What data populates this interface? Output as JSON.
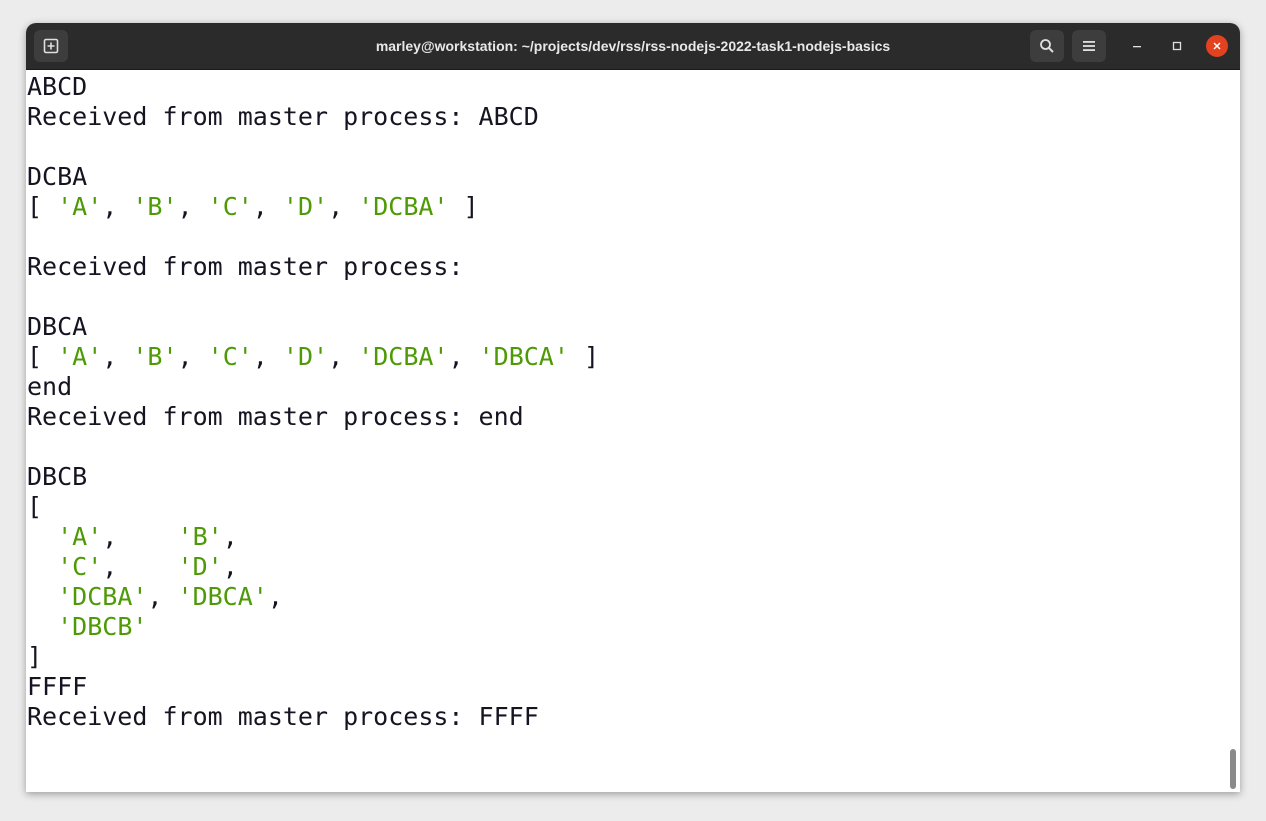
{
  "window": {
    "title": "marley@workstation: ~/projects/dev/rss/rss-nodejs-2022-task1-nodejs-basics"
  },
  "titlebar": {
    "new_tab_icon": "new-tab-icon",
    "search_icon": "search-icon",
    "menu_icon": "hamburger-menu-icon",
    "minimize_icon": "minimize-icon",
    "maximize_icon": "maximize-icon",
    "close_icon": "close-icon"
  },
  "colors": {
    "string_green": "#4e9a06",
    "text": "#171421",
    "close_red": "#e2421f"
  },
  "terminal": {
    "lines": [
      [
        {
          "t": "ABCD"
        }
      ],
      [
        {
          "t": "Received from master process: ABCD"
        }
      ],
      [],
      [
        {
          "t": "DCBA"
        }
      ],
      [
        {
          "t": "[ "
        },
        {
          "t": "'A'",
          "g": 1
        },
        {
          "t": ", "
        },
        {
          "t": "'B'",
          "g": 1
        },
        {
          "t": ", "
        },
        {
          "t": "'C'",
          "g": 1
        },
        {
          "t": ", "
        },
        {
          "t": "'D'",
          "g": 1
        },
        {
          "t": ", "
        },
        {
          "t": "'DCBA'",
          "g": 1
        },
        {
          "t": " ]"
        }
      ],
      [],
      [
        {
          "t": "Received from master process:"
        }
      ],
      [],
      [
        {
          "t": "DBCA"
        }
      ],
      [
        {
          "t": "[ "
        },
        {
          "t": "'A'",
          "g": 1
        },
        {
          "t": ", "
        },
        {
          "t": "'B'",
          "g": 1
        },
        {
          "t": ", "
        },
        {
          "t": "'C'",
          "g": 1
        },
        {
          "t": ", "
        },
        {
          "t": "'D'",
          "g": 1
        },
        {
          "t": ", "
        },
        {
          "t": "'DCBA'",
          "g": 1
        },
        {
          "t": ", "
        },
        {
          "t": "'DBCA'",
          "g": 1
        },
        {
          "t": " ]"
        }
      ],
      [
        {
          "t": "end"
        }
      ],
      [
        {
          "t": "Received from master process: end"
        }
      ],
      [],
      [
        {
          "t": "DBCB"
        }
      ],
      [
        {
          "t": "["
        }
      ],
      [
        {
          "t": "  "
        },
        {
          "t": "'A'",
          "g": 1
        },
        {
          "t": ",    "
        },
        {
          "t": "'B'",
          "g": 1
        },
        {
          "t": ","
        }
      ],
      [
        {
          "t": "  "
        },
        {
          "t": "'C'",
          "g": 1
        },
        {
          "t": ",    "
        },
        {
          "t": "'D'",
          "g": 1
        },
        {
          "t": ","
        }
      ],
      [
        {
          "t": "  "
        },
        {
          "t": "'DCBA'",
          "g": 1
        },
        {
          "t": ", "
        },
        {
          "t": "'DBCA'",
          "g": 1
        },
        {
          "t": ","
        }
      ],
      [
        {
          "t": "  "
        },
        {
          "t": "'DBCB'",
          "g": 1
        }
      ],
      [
        {
          "t": "]"
        }
      ],
      [
        {
          "t": "FFFF"
        }
      ],
      [
        {
          "t": "Received from master process: FFFF"
        }
      ]
    ]
  }
}
